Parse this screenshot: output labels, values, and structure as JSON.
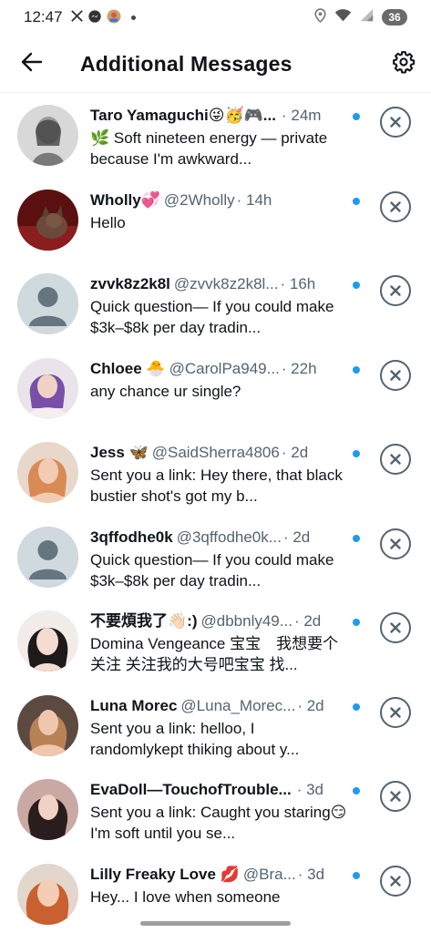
{
  "status_bar": {
    "time": "12:47",
    "left_icons": [
      "x-logo-icon",
      "messenger-icon",
      "app-avatar-icon"
    ],
    "right_icons": [
      "location-icon",
      "wifi-icon",
      "signal-icon"
    ],
    "battery": "36"
  },
  "header": {
    "title": "Additional Messages",
    "back_icon": "arrow-left-icon",
    "settings_icon": "gear-icon"
  },
  "colors": {
    "accent": "#1d9bf0",
    "secondary_text": "#536471",
    "primary_text": "#0f1419"
  },
  "messages": [
    {
      "name": "Taro Yamaguchi😜🥳🎮...",
      "handle": "",
      "time": "· 24m",
      "preview": "🌿 Soft nineteen energy — private because I'm awkward...",
      "unread": true,
      "avatar": "photo"
    },
    {
      "name": "Wholly💞",
      "handle": "@2Wholly",
      "time": "· 14h",
      "preview": "Hello",
      "unread": true,
      "avatar": "photo"
    },
    {
      "name": "zvvk8z2k8l",
      "handle": "@zvvk8z2k8l...",
      "time": "· 16h",
      "preview": "Quick question— If you could make $3k–$8k per day tradin...",
      "unread": true,
      "avatar": "default"
    },
    {
      "name": "Chloee 🐣",
      "handle": "@CarolPa949...",
      "time": "· 22h",
      "preview": "any chance ur single?",
      "unread": true,
      "avatar": "photo"
    },
    {
      "name": "Jess 🦋",
      "handle": "@SaidSherra4806",
      "time": "· 2d",
      "preview": "Sent you a link: Hey there, that black bustier shot's got my b...",
      "unread": true,
      "avatar": "photo"
    },
    {
      "name": "3qffodhe0k",
      "handle": "@3qffodhe0k...",
      "time": "· 2d",
      "preview": "Quick question— If you could make $3k–$8k per day tradin...",
      "unread": true,
      "avatar": "default"
    },
    {
      "name": "不要煩我了👋🏻:)",
      "handle": "@dbbnly49...",
      "time": "· 2d",
      "preview": "Domina Vengeance 宝宝　我想要个关注 关注我的大号吧宝宝 找...",
      "unread": true,
      "avatar": "photo"
    },
    {
      "name": "Luna Morec",
      "handle": "@Luna_Morec...",
      "time": "· 2d",
      "preview": "Sent you a link: helloo, I randomlykept thiking about y...",
      "unread": true,
      "avatar": "photo"
    },
    {
      "name": "EvaDoll—TouchofTrouble...",
      "handle": "",
      "time": "· 3d",
      "preview": "Sent you a link: Caught you staring😏 I'm soft until you se...",
      "unread": true,
      "avatar": "photo"
    },
    {
      "name": "Lilly Freaky Love 💋",
      "handle": "@Bra...",
      "time": "· 3d",
      "preview": "Hey... I love when someone",
      "unread": true,
      "avatar": "photo"
    }
  ]
}
